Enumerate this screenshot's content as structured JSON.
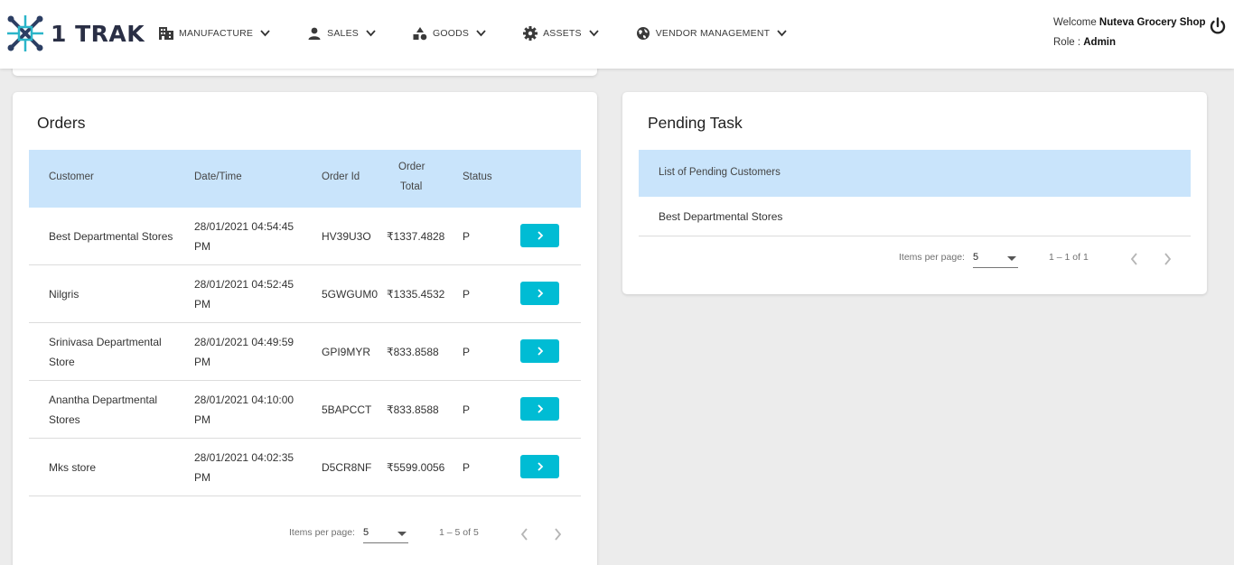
{
  "header": {
    "brand": "1 TRAK",
    "nav": [
      {
        "label": "MANUFACTURE",
        "icon": "building-icon"
      },
      {
        "label": "SALES",
        "icon": "person-icon"
      },
      {
        "label": "GOODS",
        "icon": "shapes-icon"
      },
      {
        "label": "ASSETS",
        "icon": "cog-icon"
      },
      {
        "label": "VENDOR MANAGEMENT",
        "icon": "globe-icon"
      }
    ],
    "welcome_prefix": "Welcome",
    "user_name": "Nuteva Grocery Shop",
    "role_prefix": "Role :",
    "role": "Admin"
  },
  "orders": {
    "title": "Orders",
    "columns": {
      "customer": "Customer",
      "datetime": "Date/Time",
      "order_id": "Order Id",
      "order_total_1": "Order",
      "order_total_2": "Total",
      "status": "Status"
    },
    "rows": [
      {
        "customer_1": "Best Departmental Stores",
        "customer_2": "",
        "date": "28/01/2021 04:54:45",
        "time_suffix": "PM",
        "order_id": "HV39U3O",
        "total": "₹1337.4828",
        "status": "P"
      },
      {
        "customer_1": "Nilgris",
        "customer_2": "",
        "date": "28/01/2021 04:52:45",
        "time_suffix": "PM",
        "order_id": "5GWGUM0",
        "total": "₹1335.4532",
        "status": "P"
      },
      {
        "customer_1": "Srinivasa Departmental",
        "customer_2": "Store",
        "date": "28/01/2021 04:49:59",
        "time_suffix": "PM",
        "order_id": "GPI9MYR",
        "total": "₹833.8588",
        "status": "P"
      },
      {
        "customer_1": "Anantha Departmental",
        "customer_2": "Stores",
        "date": "28/01/2021 04:10:00",
        "time_suffix": "PM",
        "order_id": "5BAPCCT",
        "total": "₹833.8588",
        "status": "P"
      },
      {
        "customer_1": "Mks store",
        "customer_2": "",
        "date": "28/01/2021 04:02:35",
        "time_suffix": "PM",
        "order_id": "D5CR8NF",
        "total": "₹5599.0056",
        "status": "P"
      }
    ],
    "paginator": {
      "items_label": "Items per page:",
      "page_size": "5",
      "range": "1 – 5 of 5"
    }
  },
  "pending": {
    "title": "Pending Task",
    "column": "List of Pending Customers",
    "rows": [
      "Best Departmental Stores"
    ],
    "paginator": {
      "items_label": "Items per page:",
      "page_size": "5",
      "range": "1 – 1 of 1"
    }
  },
  "colors": {
    "accent": "#00bcd4",
    "table_header": "#c9e4fb",
    "background": "#ececec"
  }
}
